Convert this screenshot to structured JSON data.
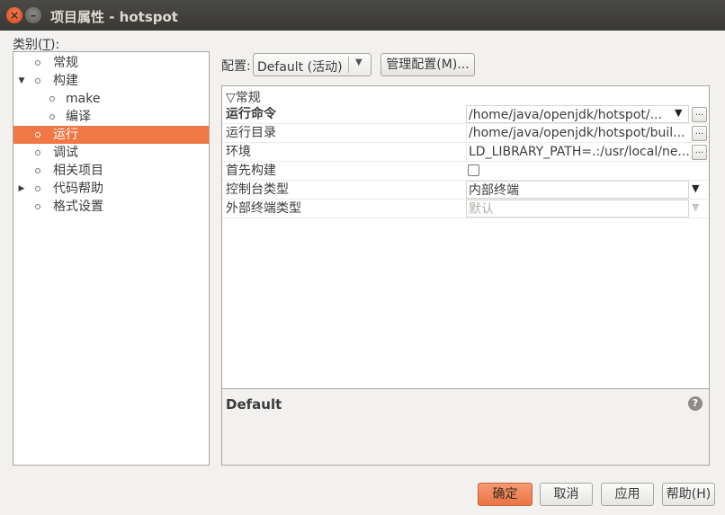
{
  "window": {
    "title": "项目属性 - hotspot",
    "close_glyph": "×",
    "minimize_glyph": "–"
  },
  "categories": {
    "label_prefix": "类别(",
    "label_mnemonic": "T",
    "label_suffix": "):",
    "items": [
      {
        "label": "常规",
        "expander": ""
      },
      {
        "label": "构建",
        "expander": "▼"
      },
      {
        "label": "make",
        "expander": ""
      },
      {
        "label": "编译",
        "expander": ""
      },
      {
        "label": "运行",
        "expander": ""
      },
      {
        "label": "调试",
        "expander": ""
      },
      {
        "label": "相关项目",
        "expander": ""
      },
      {
        "label": "代码帮助",
        "expander": "▶"
      },
      {
        "label": "格式设置",
        "expander": ""
      }
    ],
    "selected": "运行"
  },
  "config": {
    "label": "配置:",
    "value": "Default (活动)",
    "manage_label": "管理配置(M)..."
  },
  "properties": {
    "group": "▽常规",
    "rows": [
      {
        "name": "运行命令",
        "value": "/home/java/openjdk/hotspot/..."
      },
      {
        "name": "运行目录",
        "value": "/home/java/openjdk/hotspot/buil..."
      },
      {
        "name": "环境",
        "value": "LD_LIBRARY_PATH=.:/usr/local/ne..."
      },
      {
        "name": "首先构建",
        "value": ""
      },
      {
        "name": "控制台类型",
        "value": "内部终端"
      },
      {
        "name": "外部终端类型",
        "value": "默认"
      }
    ],
    "dots_label": "...",
    "arrow_glyph": "▼"
  },
  "description": {
    "title": "Default",
    "help_glyph": "?"
  },
  "buttons": {
    "ok": "确定",
    "cancel": "取消",
    "apply": "应用",
    "help": "帮助(H)"
  },
  "colors": {
    "accent": "#f07746",
    "titlebar": "#3c3b37"
  }
}
